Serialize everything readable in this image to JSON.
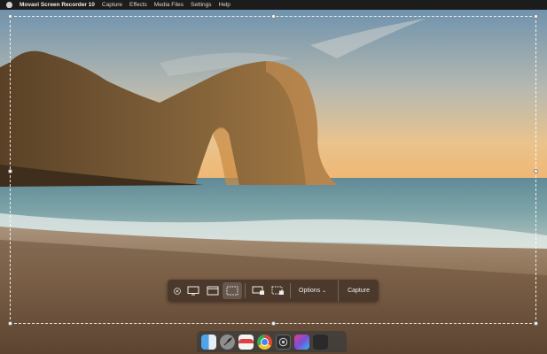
{
  "menubar": {
    "app_name": "Movavi Screen Recorder 10",
    "items": [
      "Capture",
      "Effects",
      "Media Files",
      "Settings",
      "Help"
    ]
  },
  "toolbar": {
    "options_label": "Options",
    "capture_label": "Capture"
  },
  "dock": {
    "icons": [
      "finder-icon",
      "launchpad-icon",
      "calendar-icon",
      "chrome-icon",
      "screen-recorder-icon",
      "photo-app-icon",
      "empty-slot-icon"
    ]
  },
  "colors": {
    "toolbar_bg": "#46342a",
    "menubar_bg": "#1c1c1c",
    "dock_bg": "#3c3c3c"
  }
}
